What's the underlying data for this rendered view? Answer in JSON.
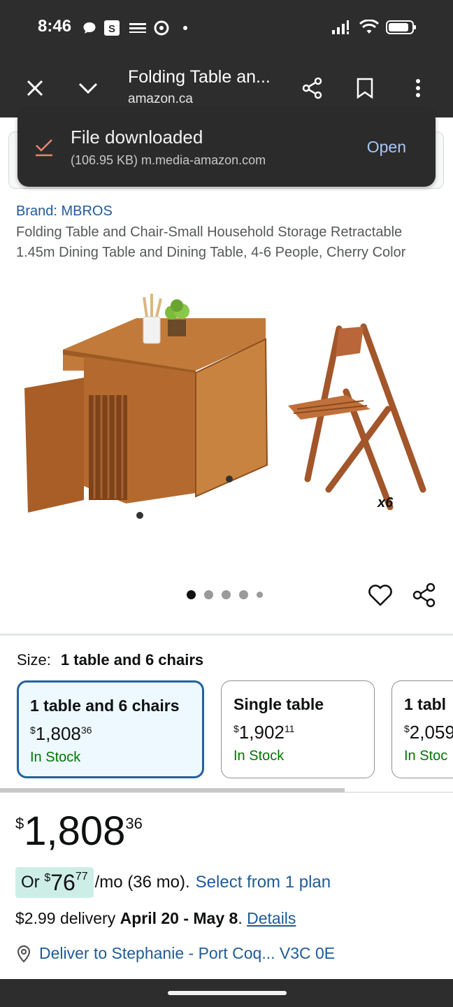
{
  "status_bar": {
    "time": "8:46"
  },
  "toolbar": {
    "title": "Folding Table an...",
    "url": "amazon.ca"
  },
  "snackbar": {
    "title": "File downloaded",
    "subtitle": "(106.95 KB) m.media-amazon.com",
    "action": "Open"
  },
  "product": {
    "brand": "Brand: MBROS",
    "title": "Folding Table and Chair-Small Household Storage Retractable 1.45m Dining Table and Dining Table, 4-6 People, Cherry Color",
    "image_badge": "x6",
    "carousel": {
      "count": 5,
      "active": 1
    }
  },
  "size": {
    "label": "Size:",
    "selected": "1 table and 6 chairs",
    "options": [
      {
        "name": "1 table and 6 chairs",
        "currency": "$",
        "dollars": "1,808",
        "cents": "36",
        "stock": "In Stock"
      },
      {
        "name": "Single table",
        "currency": "$",
        "dollars": "1,902",
        "cents": "11",
        "stock": "In Stock"
      },
      {
        "name": "1 tabl",
        "currency": "$",
        "dollars": "2,059",
        "cents": "",
        "stock": "In Stoc"
      }
    ]
  },
  "price": {
    "currency": "$",
    "dollars": "1,808",
    "cents": "36"
  },
  "plan": {
    "prefix": "Or",
    "currency": "$",
    "amount": "76",
    "cents": "77",
    "suffix": "/mo (36 mo).",
    "link": "Select from 1 plan"
  },
  "delivery": {
    "fee": "$2.99 delivery",
    "dates": "April 20 - May 8",
    "period": ".",
    "details": "Details"
  },
  "deliver_to": {
    "text": "Deliver to Stephanie - Port Coq... V3C 0E"
  },
  "colors": {
    "chrome_bg": "#2d2d2d",
    "link": "#1f5b98",
    "selected_border": "#2162a1",
    "in_stock": "#007600",
    "plan_pill": "#cdeee6",
    "snackbar_action": "#a8c7fa"
  }
}
